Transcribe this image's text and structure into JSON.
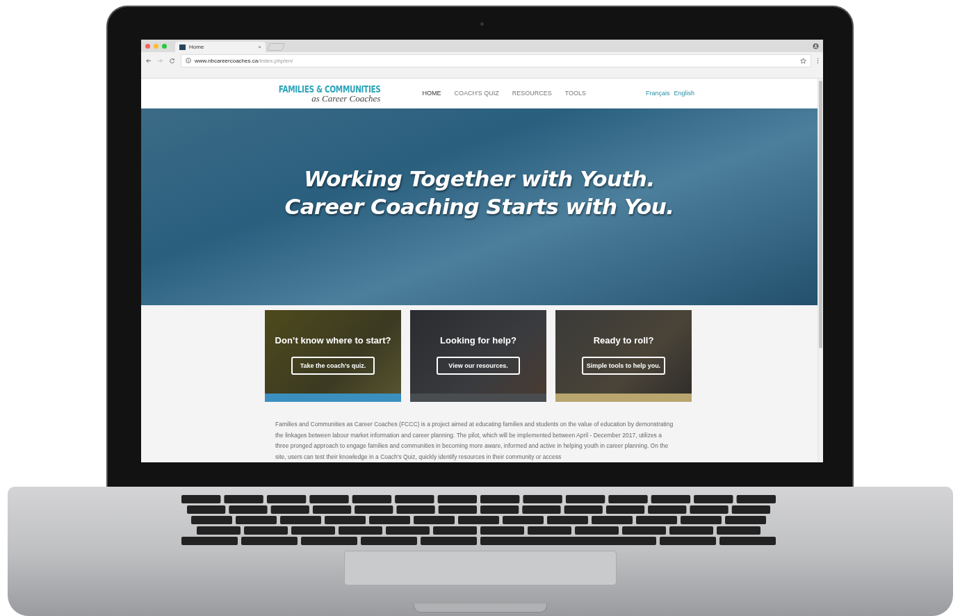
{
  "browser": {
    "tab": {
      "title": "Home",
      "close": "×"
    },
    "url": {
      "domain": "www.nbcareercoaches.ca",
      "path": "/index.php/en/"
    }
  },
  "site": {
    "logo": {
      "line1": "FAMILIES & COMMUNITIES",
      "line2": "as Career Coaches"
    },
    "nav": [
      {
        "label": "HOME",
        "selected": true
      },
      {
        "label": "COACH'S QUIZ",
        "selected": false
      },
      {
        "label": "RESOURCES",
        "selected": false
      },
      {
        "label": "TOOLS",
        "selected": false
      }
    ],
    "languages": [
      {
        "label": "Français"
      },
      {
        "label": "English"
      }
    ]
  },
  "hero": {
    "lines": [
      "Working Together with Youth.",
      "Career Coaching Starts with You."
    ]
  },
  "cards": [
    {
      "title": "Don’t know where to start?",
      "button": "Take the coach’s quiz.",
      "color": "#3b8fbf"
    },
    {
      "title": "Looking for help?",
      "button": "View our resources.",
      "color": "#4a4d50"
    },
    {
      "title": "Ready to roll?",
      "button": "Simple tools to help you.",
      "color": "#b8a66e"
    }
  ],
  "intro": "Families and Communities as Career Coaches (FCCC) is a project aimed at educating families and students on the value of education by demonstrating the linkages between labour market information and career planning. The pilot, which will be implemented between April - December 2017, utilizes a three pronged approach to engage families and communities in becoming more aware, informed and active in helping youth in career planning. On the site, users can test their knowledge in a Coach's Quiz, quickly identify resources in their community or access"
}
